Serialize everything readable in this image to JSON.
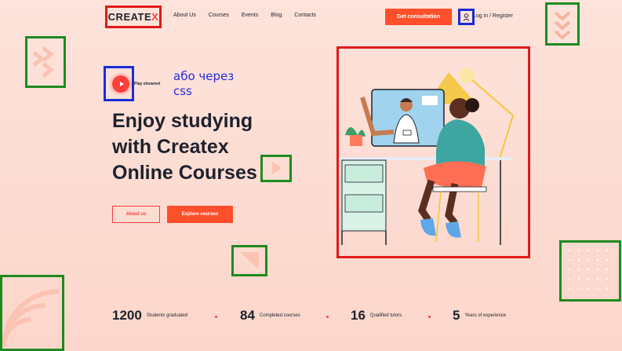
{
  "header": {
    "logo_prefix": "CREATE",
    "logo_suffix": "X",
    "nav": [
      "About Us",
      "Courses",
      "Events",
      "Blog",
      "Contacts"
    ],
    "consult_label": "Get consultation",
    "login_label": "Log in / Register"
  },
  "hero": {
    "play_label": "Play showreel",
    "note_line1": "або через",
    "note_line2": "css",
    "title_line1": "Enjoy studying",
    "title_line2": "with Createx",
    "title_line3": "Online Courses",
    "about_label": "About us",
    "explore_label": "Explore courses"
  },
  "stats": [
    {
      "number": "1200",
      "label": "Students graduated"
    },
    {
      "number": "84",
      "label": "Completed courses"
    },
    {
      "number": "16",
      "label": "Qualified tutors"
    },
    {
      "number": "5",
      "label": "Years of experience"
    }
  ],
  "colors": {
    "accent": "#ff4f2b",
    "marker_red": "#e01a1a",
    "marker_blue": "#1c2bd6",
    "marker_green": "#1f8a1f",
    "note_text": "#2a2ad8"
  }
}
